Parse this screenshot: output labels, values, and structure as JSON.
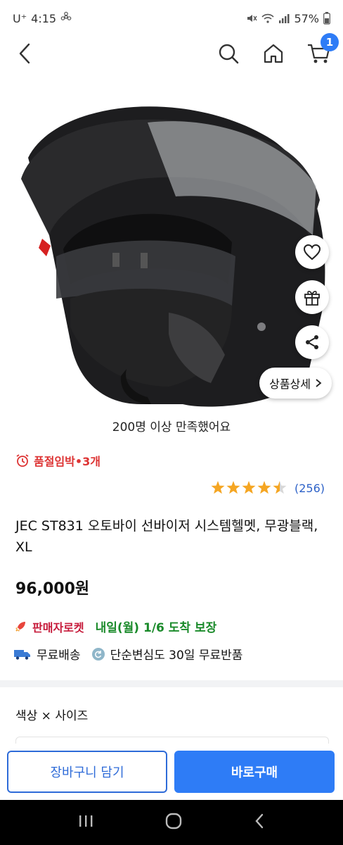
{
  "status": {
    "carrier": "U⁺",
    "time": "4:15",
    "battery": "57%"
  },
  "header": {
    "back_icon": "chevron-left-icon",
    "search_icon": "search-icon",
    "home_icon": "home-icon",
    "cart_icon": "cart-icon",
    "cart_count": "1"
  },
  "product": {
    "detail_button": "상품상세",
    "review_banner": "200명 이상 만족했어요",
    "stock_alert": "품절임박•3개",
    "rating": 4.5,
    "rating_count": "(256)",
    "title": "JEC ST831 오토바이 선바이저 시스템헬멧, 무광블랙, XL",
    "price": "96,000원",
    "rocket_label": "판매자로켓",
    "delivery_text": "내일(월) 1/6 도착 보장",
    "free_shipping": "무료배송",
    "free_return": "단순변심도 30일 무료반품",
    "option_label": "색상 × 사이즈"
  },
  "actions": {
    "add_to_cart": "장바구니 담기",
    "buy_now": "바로구매"
  },
  "colors": {
    "accent": "#2e7cf6",
    "alert": "#d33333",
    "delivery": "#1a8a2a",
    "star": "#f5a623"
  }
}
